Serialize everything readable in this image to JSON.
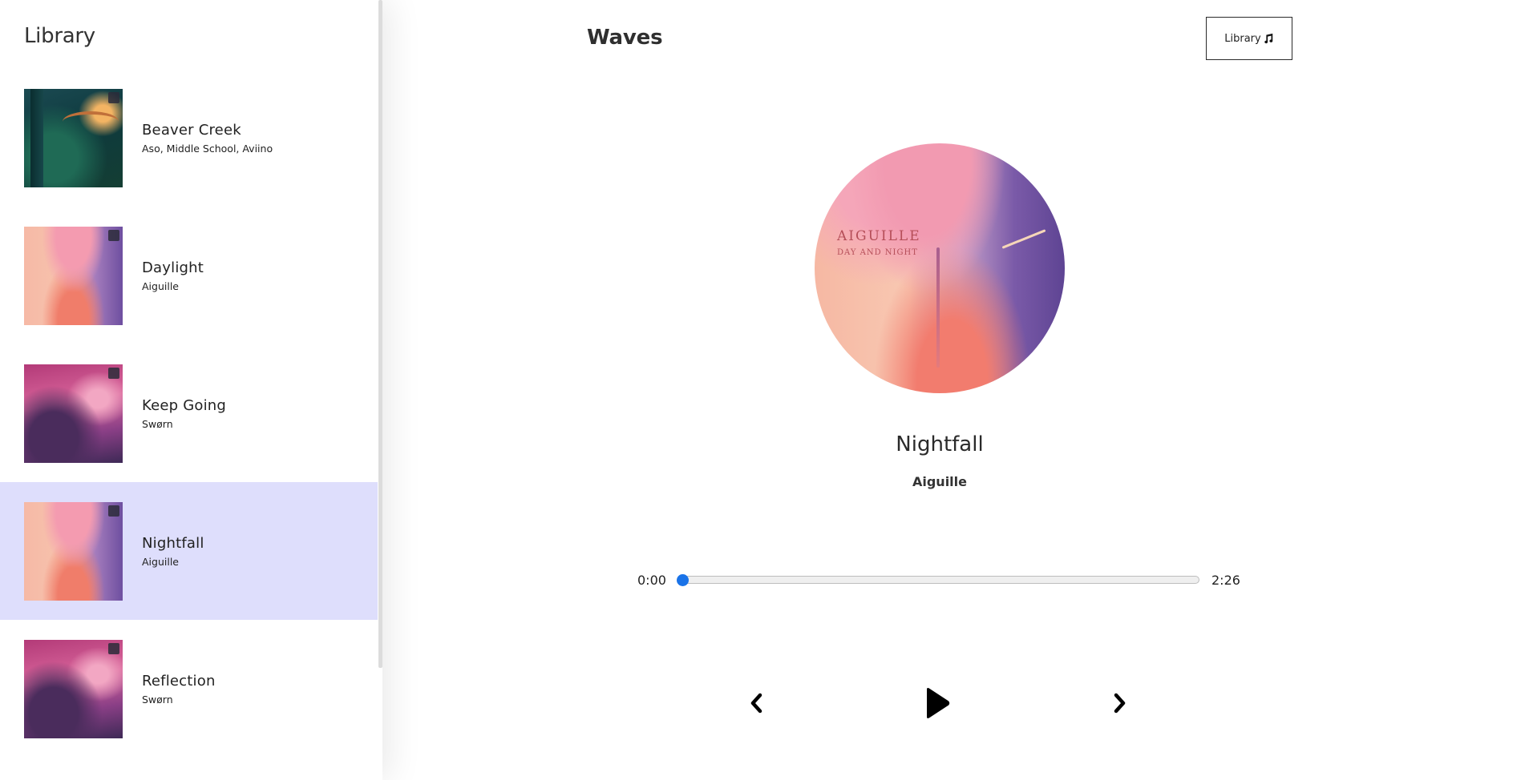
{
  "library": {
    "title": "Library",
    "songs": [
      {
        "name": "Beaver Creek",
        "artist": "Aso, Middle School, Aviino",
        "cover": "forest",
        "active": false
      },
      {
        "name": "Daylight",
        "artist": "Aiguille",
        "cover": "day-and-night",
        "active": false
      },
      {
        "name": "Keep Going",
        "artist": "Swørn",
        "cover": "night-garden",
        "active": false
      },
      {
        "name": "Nightfall",
        "artist": "Aiguille",
        "cover": "day-and-night",
        "active": true
      },
      {
        "name": "Reflection",
        "artist": "Swørn",
        "cover": "night-garden",
        "active": false
      }
    ]
  },
  "nav": {
    "title": "Waves",
    "library_button_label": "Library",
    "library_button_icon": "music-note-icon"
  },
  "player": {
    "track_name": "Nightfall",
    "track_artist": "Aiguille",
    "album_art": {
      "title": "AIGUILLE",
      "subtitle": "DAY AND NIGHT"
    },
    "current_time": "0:00",
    "total_time": "2:26",
    "progress_fraction": 0,
    "accent_color": "#1a73e8",
    "controls": {
      "previous_icon": "chevron-left-icon",
      "play_icon": "play-icon",
      "next_icon": "chevron-right-icon"
    }
  },
  "colors": {
    "active_row": "#dedefc"
  }
}
